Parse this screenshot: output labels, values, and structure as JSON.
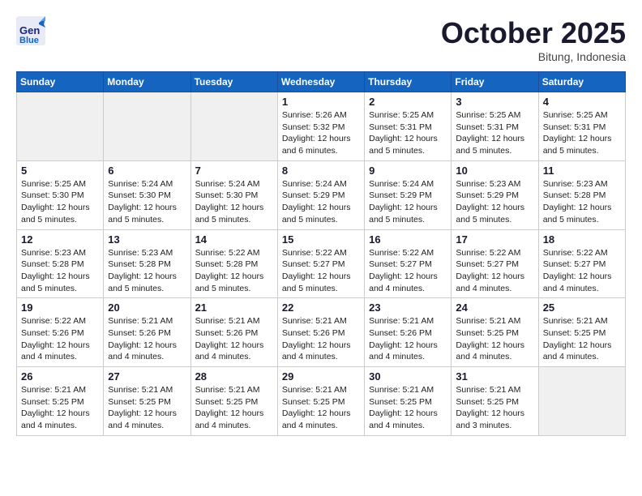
{
  "header": {
    "logo_general": "General",
    "logo_blue": "Blue",
    "month": "October 2025",
    "location": "Bitung, Indonesia"
  },
  "weekdays": [
    "Sunday",
    "Monday",
    "Tuesday",
    "Wednesday",
    "Thursday",
    "Friday",
    "Saturday"
  ],
  "weeks": [
    [
      {
        "day": "",
        "info": ""
      },
      {
        "day": "",
        "info": ""
      },
      {
        "day": "",
        "info": ""
      },
      {
        "day": "1",
        "info": "Sunrise: 5:26 AM\nSunset: 5:32 PM\nDaylight: 12 hours\nand 6 minutes."
      },
      {
        "day": "2",
        "info": "Sunrise: 5:25 AM\nSunset: 5:31 PM\nDaylight: 12 hours\nand 5 minutes."
      },
      {
        "day": "3",
        "info": "Sunrise: 5:25 AM\nSunset: 5:31 PM\nDaylight: 12 hours\nand 5 minutes."
      },
      {
        "day": "4",
        "info": "Sunrise: 5:25 AM\nSunset: 5:31 PM\nDaylight: 12 hours\nand 5 minutes."
      }
    ],
    [
      {
        "day": "5",
        "info": "Sunrise: 5:25 AM\nSunset: 5:30 PM\nDaylight: 12 hours\nand 5 minutes."
      },
      {
        "day": "6",
        "info": "Sunrise: 5:24 AM\nSunset: 5:30 PM\nDaylight: 12 hours\nand 5 minutes."
      },
      {
        "day": "7",
        "info": "Sunrise: 5:24 AM\nSunset: 5:30 PM\nDaylight: 12 hours\nand 5 minutes."
      },
      {
        "day": "8",
        "info": "Sunrise: 5:24 AM\nSunset: 5:29 PM\nDaylight: 12 hours\nand 5 minutes."
      },
      {
        "day": "9",
        "info": "Sunrise: 5:24 AM\nSunset: 5:29 PM\nDaylight: 12 hours\nand 5 minutes."
      },
      {
        "day": "10",
        "info": "Sunrise: 5:23 AM\nSunset: 5:29 PM\nDaylight: 12 hours\nand 5 minutes."
      },
      {
        "day": "11",
        "info": "Sunrise: 5:23 AM\nSunset: 5:28 PM\nDaylight: 12 hours\nand 5 minutes."
      }
    ],
    [
      {
        "day": "12",
        "info": "Sunrise: 5:23 AM\nSunset: 5:28 PM\nDaylight: 12 hours\nand 5 minutes."
      },
      {
        "day": "13",
        "info": "Sunrise: 5:23 AM\nSunset: 5:28 PM\nDaylight: 12 hours\nand 5 minutes."
      },
      {
        "day": "14",
        "info": "Sunrise: 5:22 AM\nSunset: 5:28 PM\nDaylight: 12 hours\nand 5 minutes."
      },
      {
        "day": "15",
        "info": "Sunrise: 5:22 AM\nSunset: 5:27 PM\nDaylight: 12 hours\nand 5 minutes."
      },
      {
        "day": "16",
        "info": "Sunrise: 5:22 AM\nSunset: 5:27 PM\nDaylight: 12 hours\nand 4 minutes."
      },
      {
        "day": "17",
        "info": "Sunrise: 5:22 AM\nSunset: 5:27 PM\nDaylight: 12 hours\nand 4 minutes."
      },
      {
        "day": "18",
        "info": "Sunrise: 5:22 AM\nSunset: 5:27 PM\nDaylight: 12 hours\nand 4 minutes."
      }
    ],
    [
      {
        "day": "19",
        "info": "Sunrise: 5:22 AM\nSunset: 5:26 PM\nDaylight: 12 hours\nand 4 minutes."
      },
      {
        "day": "20",
        "info": "Sunrise: 5:21 AM\nSunset: 5:26 PM\nDaylight: 12 hours\nand 4 minutes."
      },
      {
        "day": "21",
        "info": "Sunrise: 5:21 AM\nSunset: 5:26 PM\nDaylight: 12 hours\nand 4 minutes."
      },
      {
        "day": "22",
        "info": "Sunrise: 5:21 AM\nSunset: 5:26 PM\nDaylight: 12 hours\nand 4 minutes."
      },
      {
        "day": "23",
        "info": "Sunrise: 5:21 AM\nSunset: 5:26 PM\nDaylight: 12 hours\nand 4 minutes."
      },
      {
        "day": "24",
        "info": "Sunrise: 5:21 AM\nSunset: 5:25 PM\nDaylight: 12 hours\nand 4 minutes."
      },
      {
        "day": "25",
        "info": "Sunrise: 5:21 AM\nSunset: 5:25 PM\nDaylight: 12 hours\nand 4 minutes."
      }
    ],
    [
      {
        "day": "26",
        "info": "Sunrise: 5:21 AM\nSunset: 5:25 PM\nDaylight: 12 hours\nand 4 minutes."
      },
      {
        "day": "27",
        "info": "Sunrise: 5:21 AM\nSunset: 5:25 PM\nDaylight: 12 hours\nand 4 minutes."
      },
      {
        "day": "28",
        "info": "Sunrise: 5:21 AM\nSunset: 5:25 PM\nDaylight: 12 hours\nand 4 minutes."
      },
      {
        "day": "29",
        "info": "Sunrise: 5:21 AM\nSunset: 5:25 PM\nDaylight: 12 hours\nand 4 minutes."
      },
      {
        "day": "30",
        "info": "Sunrise: 5:21 AM\nSunset: 5:25 PM\nDaylight: 12 hours\nand 4 minutes."
      },
      {
        "day": "31",
        "info": "Sunrise: 5:21 AM\nSunset: 5:25 PM\nDaylight: 12 hours\nand 3 minutes."
      },
      {
        "day": "",
        "info": ""
      }
    ]
  ]
}
